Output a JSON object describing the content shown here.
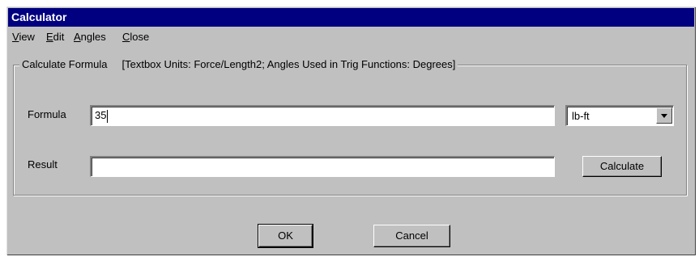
{
  "window": {
    "title": "Calculator"
  },
  "menu": [
    {
      "key": "V",
      "rest": "iew"
    },
    {
      "key": "E",
      "rest": "dit"
    },
    {
      "key": "A",
      "rest": "ngles"
    },
    {
      "key": "C",
      "rest": "lose"
    }
  ],
  "group": {
    "label_main": "Calculate Formula",
    "label_units": "[Textbox Units:  Force/Length2;   Angles Used in Trig Functions:  Degrees]"
  },
  "formula": {
    "label": "Formula",
    "value": "35"
  },
  "units_select": {
    "value": "lb-ft"
  },
  "result": {
    "label": "Result",
    "value": ""
  },
  "buttons": {
    "calculate": "Calculate",
    "ok": "OK",
    "cancel": "Cancel"
  }
}
